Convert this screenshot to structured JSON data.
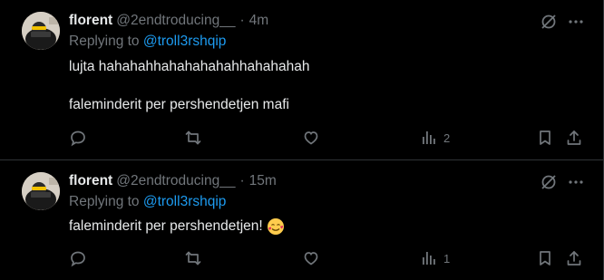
{
  "colors": {
    "background": "#000000",
    "text": "#e7e9ea",
    "muted": "#71767b",
    "link": "#1d9bf0",
    "divider": "#2f3336"
  },
  "tweets": [
    {
      "name": "florent",
      "handle": "@2endtroducing__",
      "separator": "·",
      "time": "4m",
      "reply_prefix": "Replying to",
      "reply_to": "@troll3rshqip",
      "lines": [
        "lujta hahahahhahahahahahhahahahah",
        "faleminderit per pershendetjen mafi"
      ],
      "views": "2",
      "icons": [
        "reply-icon",
        "retweet-icon",
        "like-icon",
        "views-icon",
        "bookmark-icon",
        "share-icon",
        "grok-icon",
        "more-icon"
      ]
    },
    {
      "name": "florent",
      "handle": "@2endtroducing__",
      "separator": "·",
      "time": "15m",
      "reply_prefix": "Replying to",
      "reply_to": "@troll3rshqip",
      "lines": [
        "faleminderit per pershendetjen!"
      ],
      "emoji": "smiling-face-with-hearts",
      "views": "1",
      "icons": [
        "reply-icon",
        "retweet-icon",
        "like-icon",
        "views-icon",
        "bookmark-icon",
        "share-icon",
        "grok-icon",
        "more-icon"
      ]
    }
  ]
}
